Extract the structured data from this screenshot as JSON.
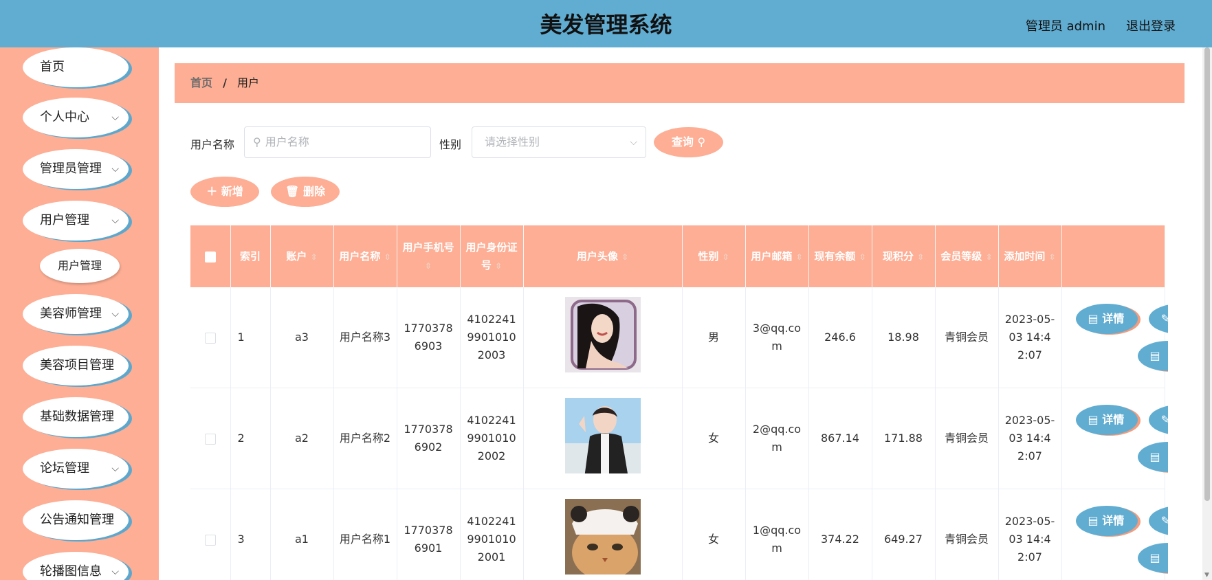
{
  "header": {
    "title": "美发管理系统",
    "user": "管理员 admin",
    "logout": "退出登录"
  },
  "sidebar": {
    "items": [
      {
        "label": "首页"
      },
      {
        "label": "个人中心"
      },
      {
        "label": "管理员管理"
      },
      {
        "label": "用户管理"
      },
      {
        "label": "美容师管理"
      },
      {
        "label": "美容项目管理"
      },
      {
        "label": "基础数据管理"
      },
      {
        "label": "论坛管理"
      },
      {
        "label": "公告通知管理"
      },
      {
        "label": "轮播图信息"
      }
    ],
    "submenu": "用户管理"
  },
  "breadcrumb": {
    "home": "首页",
    "separator": "/",
    "current": "用户"
  },
  "search": {
    "name_label": "用户名称",
    "name_placeholder": "用户名称",
    "gender_label": "性别",
    "gender_placeholder": "请选择性别",
    "query_label": "查询"
  },
  "actions": {
    "add": "新增",
    "delete": "删除"
  },
  "table": {
    "headers": [
      "索引",
      "账户",
      "用户名称",
      "用户手机号",
      "用户身份证号",
      "用户头像",
      "性别",
      "用户邮箱",
      "现有余额",
      "现积分",
      "会员等级",
      "添加时间"
    ],
    "rows": [
      {
        "index": "1",
        "account": "a3",
        "name": "用户名称3",
        "phone": "17703786903",
        "id_card": "410224199010102003",
        "gender": "男",
        "email": "3@qq.com",
        "balance": "246.6",
        "points": "18.98",
        "level": "青铜会员",
        "time": "2023-05-03 14:42:07",
        "detail": "详情"
      },
      {
        "index": "2",
        "account": "a2",
        "name": "用户名称2",
        "phone": "17703786902",
        "id_card": "410224199010102002",
        "gender": "女",
        "email": "2@qq.com",
        "balance": "867.14",
        "points": "171.88",
        "level": "青铜会员",
        "time": "2023-05-03 14:42:07",
        "detail": "详情"
      },
      {
        "index": "3",
        "account": "a1",
        "name": "用户名称1",
        "phone": "17703786901",
        "id_card": "410224199010102001",
        "gender": "女",
        "email": "1@qq.com",
        "balance": "374.22",
        "points": "649.27",
        "level": "青铜会员",
        "time": "2023-05-03 14:42:07",
        "detail": "详情"
      }
    ]
  },
  "colors": {
    "header": "#61add2",
    "accent": "#fdae94",
    "button_blue": "#61add2"
  }
}
